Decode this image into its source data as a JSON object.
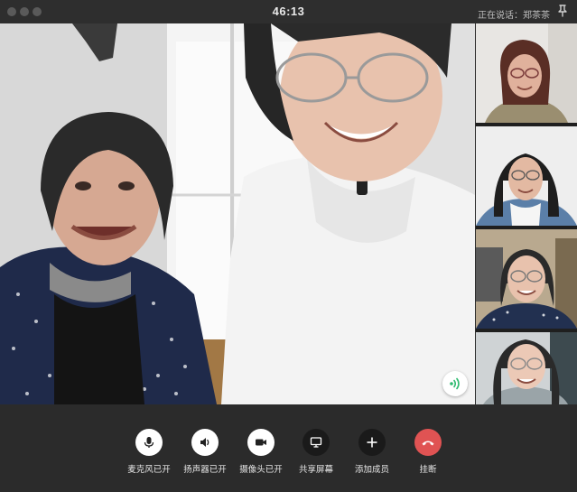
{
  "titlebar": {
    "timer": "46:13",
    "speaking_label": "正在说话：郑茶茶",
    "pin_icon": "pin-icon"
  },
  "main_video": {
    "speaker_indicator_icon": "speaker-wave-icon"
  },
  "participants": [
    {
      "icon": "participant-video"
    },
    {
      "icon": "participant-video"
    },
    {
      "icon": "participant-video"
    },
    {
      "icon": "participant-video"
    }
  ],
  "toolbar": {
    "mic_label": "麦克风已开",
    "speaker_label": "扬声器已开",
    "camera_label": "摄像头已开",
    "share_label": "共享屏幕",
    "add_label": "添加成员",
    "hangup_label": "挂断"
  },
  "colors": {
    "hangup": "#e05353",
    "indicator": "#2dbb6f",
    "background": "#2b2b2b"
  }
}
